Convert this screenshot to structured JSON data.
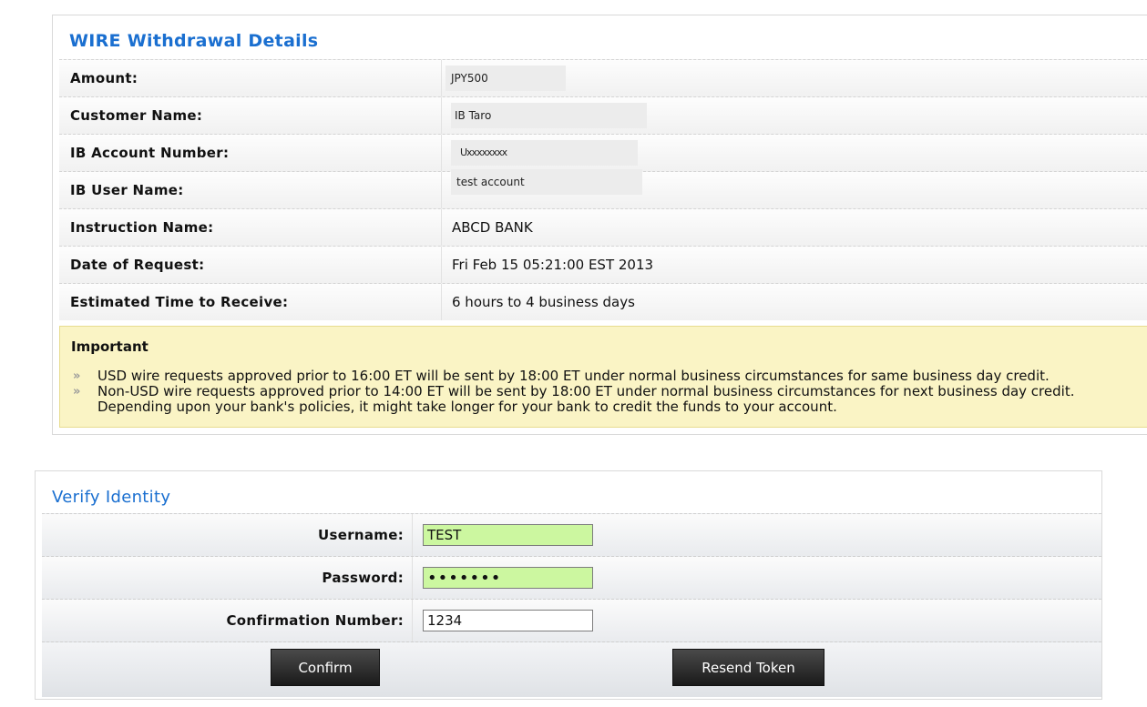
{
  "withdrawal": {
    "title": "WIRE Withdrawal Details",
    "rows": [
      {
        "label": "Amount:",
        "value": "JPY500"
      },
      {
        "label": "Customer Name:",
        "value": "IB Taro"
      },
      {
        "label": "IB Account Number:",
        "value": "Uxxxxxxxx"
      },
      {
        "label": "IB User Name:",
        "value": "test account"
      },
      {
        "label": "Instruction Name:",
        "value": "ABCD BANK"
      },
      {
        "label": "Date of Request:",
        "value": "Fri Feb 15 05:21:00 EST 2013"
      },
      {
        "label": "Estimated Time to Receive:",
        "value": "6 hours to 4 business days"
      }
    ]
  },
  "important": {
    "title": "Important",
    "bullet_glyph": "»",
    "items": [
      "USD wire requests approved prior to 16:00 ET will be sent by 18:00 ET under normal business circumstances for same business day credit.",
      "Non-USD wire requests approved prior to 14:00 ET will be sent by 18:00 ET under normal business circumstances for next business day credit. Depending upon your bank's policies, it might take longer for your bank to credit the funds to your account."
    ]
  },
  "verify": {
    "title": "Verify Identity",
    "username": {
      "label": "Username:",
      "value": "TEST"
    },
    "password": {
      "label": "Password:",
      "value": "1234567"
    },
    "confirmation": {
      "label": "Confirmation Number:",
      "value": "1234"
    },
    "confirm_button": "Confirm",
    "resend_button": "Resend Token"
  },
  "colors": {
    "title_blue": "#1a6fd0",
    "important_bg": "#faf4c5",
    "highlight_input": "#ccf7a0"
  }
}
